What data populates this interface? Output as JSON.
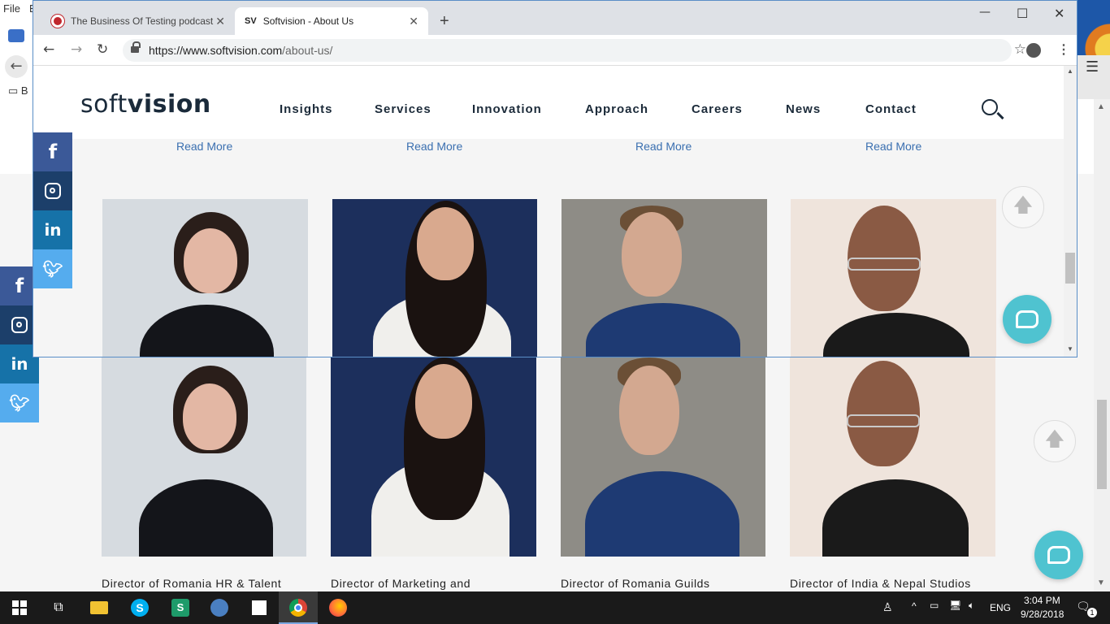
{
  "background_window": {
    "menu": [
      "File",
      "E"
    ],
    "bookmark_fragment": "B",
    "people": [
      {
        "title": "Director of Romania HR & Talent"
      },
      {
        "title": "Director of Marketing and"
      },
      {
        "title": "Director of Romania Guilds"
      },
      {
        "title": "Director of India & Nepal Studios"
      }
    ]
  },
  "chrome": {
    "tabs": [
      {
        "label": "The Business Of Testing podcast",
        "favicon": "podcast-icon",
        "active": false
      },
      {
        "label": "Softvision - About Us",
        "favicon": "SV",
        "active": true
      }
    ],
    "url_domain": "https://www.softvision.com",
    "url_path": "/about-us/"
  },
  "site": {
    "logo_light": "soft",
    "logo_bold": "vision",
    "nav": [
      "Insights",
      "Services",
      "Innovation",
      "Approach",
      "Careers",
      "News",
      "Contact"
    ],
    "read_more": "Read More"
  },
  "social_icons": [
    "facebook-icon",
    "instagram-icon",
    "linkedin-icon",
    "twitter-icon"
  ],
  "taskbar": {
    "time": "3:04 PM",
    "date": "9/28/2018",
    "lang": "ENG",
    "notification_count": "1"
  },
  "colors": {
    "facebook": "#3b5998",
    "instagram": "#1c3f6a",
    "linkedin": "#1672a8",
    "twitter": "#55acee",
    "chat": "#4fc3d0",
    "link": "#3a6fb0"
  }
}
